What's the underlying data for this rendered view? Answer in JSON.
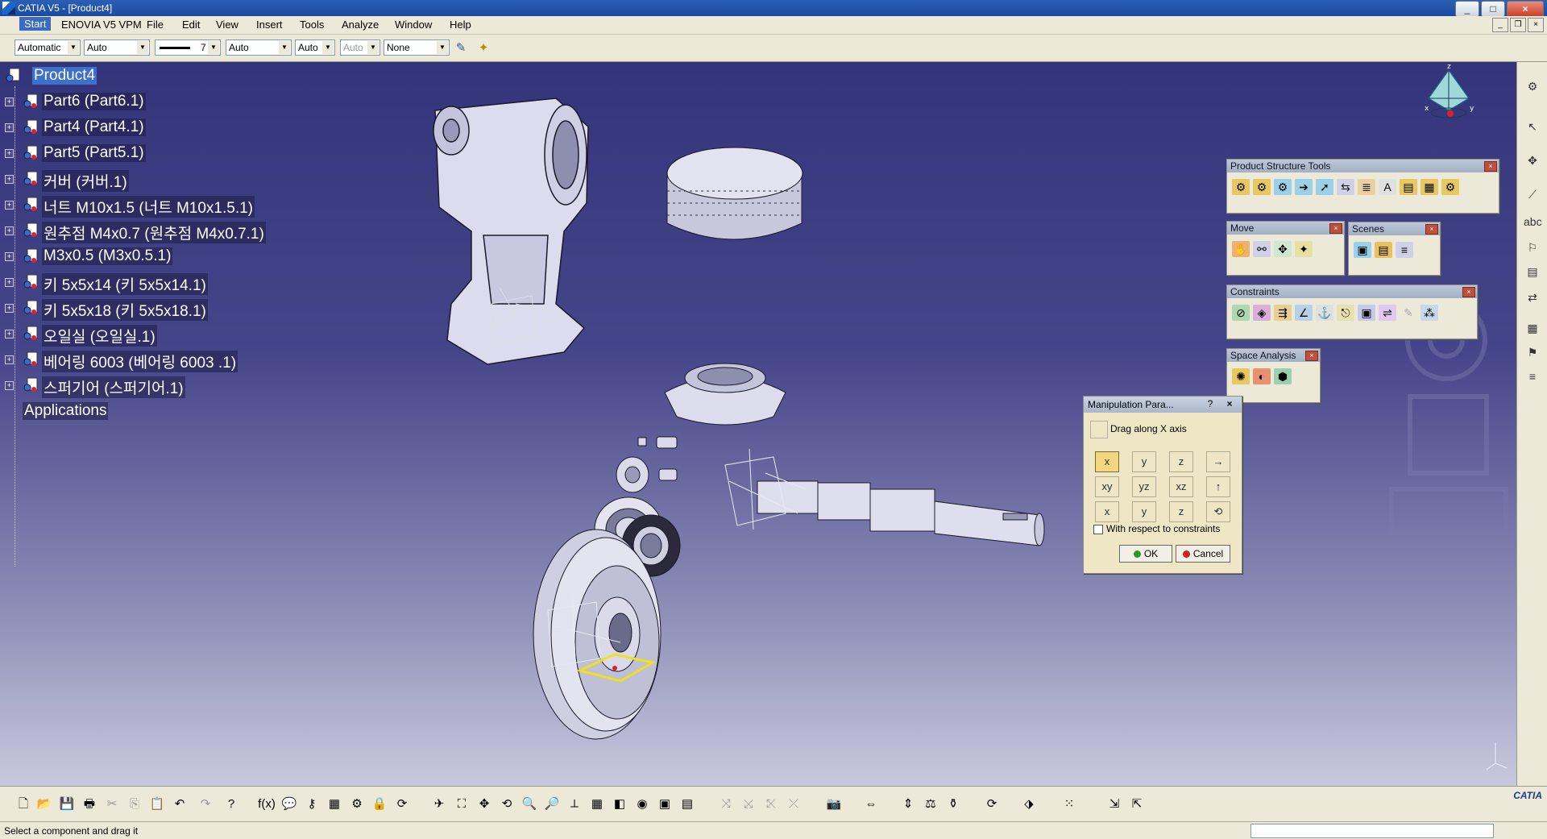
{
  "window": {
    "title": "CATIA V5 - [Product4]",
    "minimize": "_",
    "restore": "□",
    "close": "×"
  },
  "menu": {
    "start": "Start",
    "items": [
      "ENOVIA V5 VPM",
      "File",
      "Edit",
      "View",
      "Insert",
      "Tools",
      "Analyze",
      "Window",
      "Help"
    ]
  },
  "graphic_properties": {
    "color": "Automatic",
    "transparency": "Auto",
    "line_thickness": "7",
    "line_type": "Auto",
    "point_type": "Auto",
    "layer_disabled": "Auto",
    "layer": "None"
  },
  "tree": {
    "root": "Product4",
    "nodes": [
      "Part6 (Part6.1)",
      "Part4 (Part4.1)",
      "Part5 (Part5.1)",
      "커버 (커버.1)",
      "너트 M10x1.5 (너트 M10x1.5.1)",
      "원추점 M4x0.7 (원추점 M4x0.7.1)",
      "M3x0.5 (M3x0.5.1)",
      "키 5x5x14 (키 5x5x14.1)",
      "키 5x5x18 (키 5x5x18.1)",
      "오일실 (오일실.1)",
      "베어링 6003  (베어링 6003 .1)",
      "스퍼기어 (스퍼기어.1)"
    ],
    "applications": "Applications"
  },
  "toolbars": {
    "product_structure": "Product Structure Tools",
    "move": "Move",
    "scenes": "Scenes",
    "constraints": "Constraints",
    "space_analysis": "Space Analysis"
  },
  "dialog": {
    "title": "Manipulation Para...",
    "help": "?",
    "close": "×",
    "drag_text": "Drag along X axis",
    "buttons": [
      "x",
      "y",
      "z",
      "→",
      "xy",
      "yz",
      "xz",
      "↑",
      "x",
      "y",
      "z",
      "⟲"
    ],
    "checkbox": "With respect to constraints",
    "ok": "OK",
    "cancel": "Cancel"
  },
  "status": {
    "message": "Select a component and drag it"
  },
  "compass": {
    "z": "z",
    "x": "x",
    "y": "y"
  },
  "logo": "CATIA",
  "colors": {
    "selection": "#3d6fcc",
    "viewport_top": "#34347a",
    "viewport_bottom": "#c8c8dd",
    "highlight_box": "#f0e020"
  }
}
